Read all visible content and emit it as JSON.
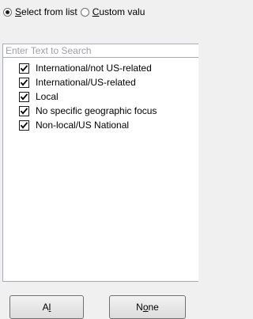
{
  "mode": {
    "select_from_list": {
      "label_accel": "S",
      "label_rest": "elect from list",
      "selected": true
    },
    "custom_value": {
      "label_accel": "C",
      "label_rest": "ustom valu",
      "selected": false
    }
  },
  "search": {
    "placeholder": "Enter Text to Search"
  },
  "items": [
    {
      "label": "International/not US-related",
      "checked": true
    },
    {
      "label": "International/US-related",
      "checked": true
    },
    {
      "label": "Local",
      "checked": true
    },
    {
      "label": "No specific geographic focus",
      "checked": true
    },
    {
      "label": "Non-local/US National",
      "checked": true
    }
  ],
  "buttons": {
    "all": {
      "accel_pre": "A",
      "accel": "l",
      "post": ""
    },
    "none": {
      "accel_pre": "N",
      "accel": "o",
      "post": "ne"
    }
  }
}
